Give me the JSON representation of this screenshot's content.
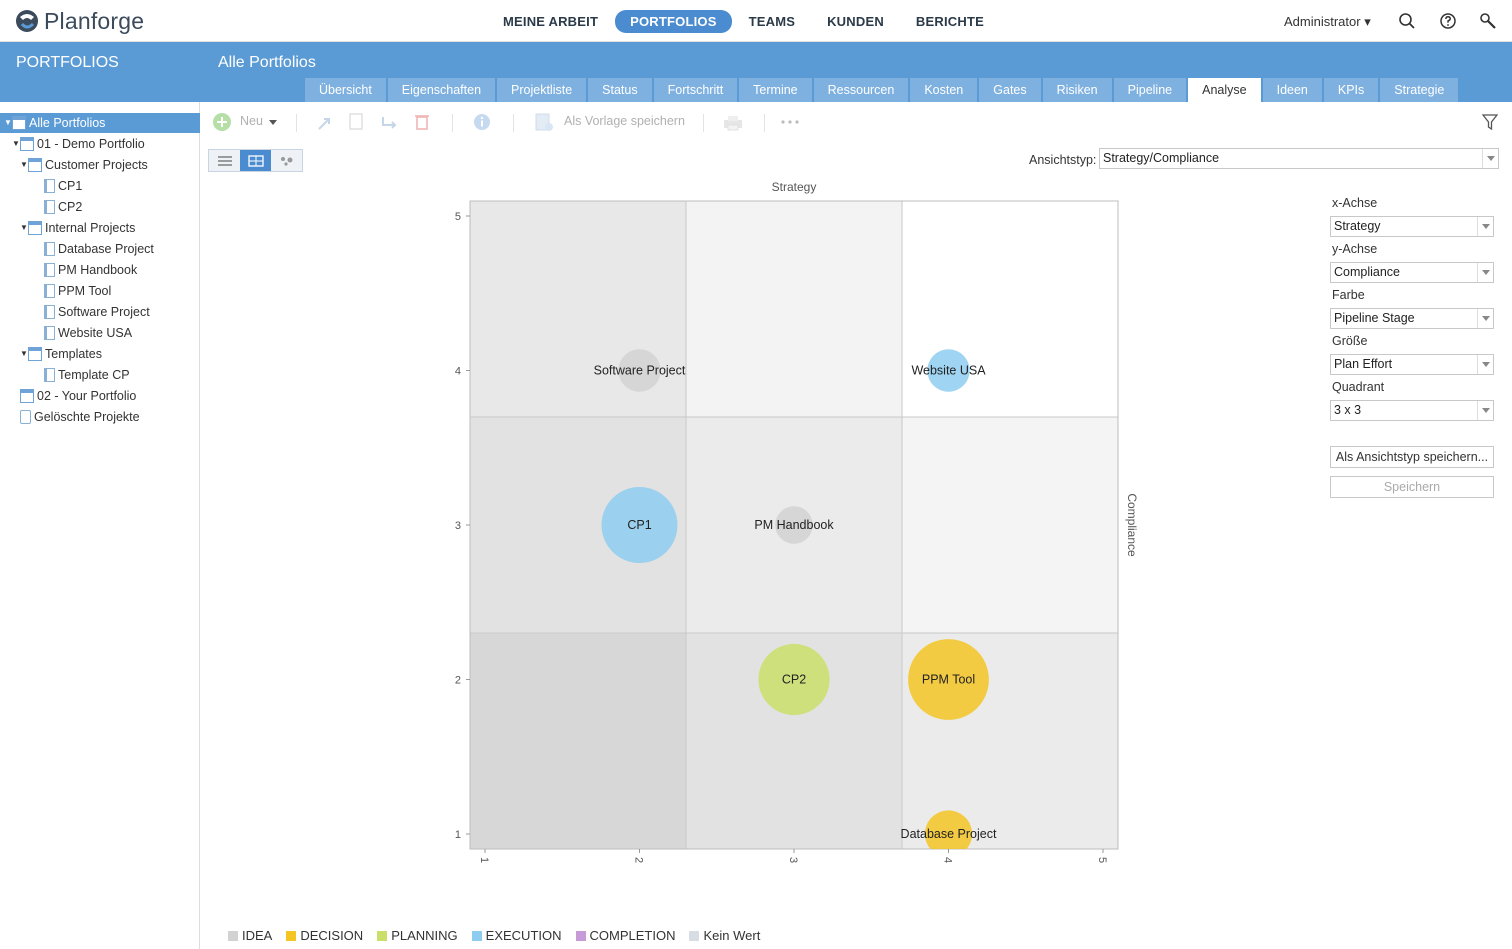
{
  "app": {
    "name": "Planforge"
  },
  "main_nav": [
    {
      "label": "MEINE ARBEIT",
      "active": false
    },
    {
      "label": "PORTFOLIOS",
      "active": true
    },
    {
      "label": "TEAMS",
      "active": false
    },
    {
      "label": "KUNDEN",
      "active": false
    },
    {
      "label": "BERICHTE",
      "active": false
    }
  ],
  "user": {
    "label": "Administrator ▾"
  },
  "sidebar": {
    "title": "PORTFOLIOS"
  },
  "header": {
    "title": "Alle Portfolios"
  },
  "tabs": [
    {
      "label": "Übersicht",
      "active": false
    },
    {
      "label": "Eigenschaften",
      "active": false
    },
    {
      "label": "Projektliste",
      "active": false
    },
    {
      "label": "Status",
      "active": false
    },
    {
      "label": "Fortschritt",
      "active": false
    },
    {
      "label": "Termine",
      "active": false
    },
    {
      "label": "Ressourcen",
      "active": false
    },
    {
      "label": "Kosten",
      "active": false
    },
    {
      "label": "Gates",
      "active": false
    },
    {
      "label": "Risiken",
      "active": false
    },
    {
      "label": "Pipeline",
      "active": false
    },
    {
      "label": "Analyse",
      "active": true
    },
    {
      "label": "Ideen",
      "active": false
    },
    {
      "label": "KPIs",
      "active": false
    },
    {
      "label": "Strategie",
      "active": false
    }
  ],
  "tree": [
    {
      "label": "Alle Portfolios",
      "level": 0,
      "icon": "portfolio-icon",
      "expanded": true,
      "selected": true
    },
    {
      "label": "01 - Demo Portfolio",
      "level": 1,
      "icon": "portfolio-icon",
      "expanded": true
    },
    {
      "label": "Customer Projects",
      "level": 2,
      "icon": "folder-icon",
      "expanded": true
    },
    {
      "label": "CP1",
      "level": 3,
      "icon": "project-icon"
    },
    {
      "label": "CP2",
      "level": 3,
      "icon": "project-icon"
    },
    {
      "label": "Internal Projects",
      "level": 2,
      "icon": "folder-icon",
      "expanded": true
    },
    {
      "label": "Database Project",
      "level": 3,
      "icon": "project-icon"
    },
    {
      "label": "PM Handbook",
      "level": 3,
      "icon": "project-icon"
    },
    {
      "label": "PPM Tool",
      "level": 3,
      "icon": "project-icon"
    },
    {
      "label": "Software Project",
      "level": 3,
      "icon": "project-icon"
    },
    {
      "label": "Website USA",
      "level": 3,
      "icon": "project-icon"
    },
    {
      "label": "Templates",
      "level": 2,
      "icon": "folder-icon",
      "expanded": true
    },
    {
      "label": "Template CP",
      "level": 3,
      "icon": "template-icon"
    },
    {
      "label": "02 - Your Portfolio",
      "level": 1,
      "icon": "portfolio-icon"
    },
    {
      "label": "Gelöschte Projekte",
      "level": 1,
      "icon": "trash-icon"
    }
  ],
  "toolbar": {
    "new_label": "Neu",
    "save_template_label": "Als Vorlage speichern"
  },
  "view_type": {
    "label": "Ansichtstyp:",
    "value": "Strategy/Compliance"
  },
  "settings": {
    "x_label": "x-Achse",
    "x_value": "Strategy",
    "y_label": "y-Achse",
    "y_value": "Compliance",
    "color_label": "Farbe",
    "color_value": "Pipeline Stage",
    "size_label": "Größe",
    "size_value": "Plan Effort",
    "quadrant_label": "Quadrant",
    "quadrant_value": "3 x 3",
    "save_as_label": "Als Ansichtstyp speichern...",
    "save_label": "Speichern"
  },
  "chart_data": {
    "type": "scatter",
    "title": "Strategy",
    "xlabel": "Strategy",
    "ylabel": "Compliance",
    "xlim": [
      1,
      5
    ],
    "ylim": [
      1,
      5
    ],
    "xticks": [
      1,
      2,
      3,
      4,
      5
    ],
    "yticks": [
      1,
      2,
      3,
      4,
      5
    ],
    "quadrants": "3 x 3",
    "points": [
      {
        "name": "Software Project",
        "x": 2,
        "y": 4,
        "stage": "IDEA",
        "size": 0.3
      },
      {
        "name": "Website USA",
        "x": 4,
        "y": 4,
        "stage": "EXECUTION",
        "size": 0.3
      },
      {
        "name": "CP1",
        "x": 2,
        "y": 3,
        "stage": "EXECUTION",
        "size": 1.0
      },
      {
        "name": "PM Handbook",
        "x": 3,
        "y": 3,
        "stage": "IDEA",
        "size": 0.2
      },
      {
        "name": "CP2",
        "x": 3,
        "y": 2,
        "stage": "PLANNING",
        "size": 0.9
      },
      {
        "name": "PPM Tool",
        "x": 4,
        "y": 2,
        "stage": "DECISION",
        "size": 1.1
      },
      {
        "name": "Database Project",
        "x": 4,
        "y": 1,
        "stage": "DECISION",
        "size": 0.4
      }
    ],
    "legend": [
      {
        "label": "IDEA",
        "color": "#d2d2d2"
      },
      {
        "label": "DECISION",
        "color": "#f5c524"
      },
      {
        "label": "PLANNING",
        "color": "#c9df6a"
      },
      {
        "label": "EXECUTION",
        "color": "#8ecdf0"
      },
      {
        "label": "COMPLETION",
        "color": "#c79ad8"
      },
      {
        "label": "Kein Wert",
        "color": "#d7dde3"
      }
    ]
  },
  "colors": {
    "accent": "#5b9bd5",
    "nav_active": "#4a8ccf",
    "tab_inactive": "#7fb1e0"
  }
}
